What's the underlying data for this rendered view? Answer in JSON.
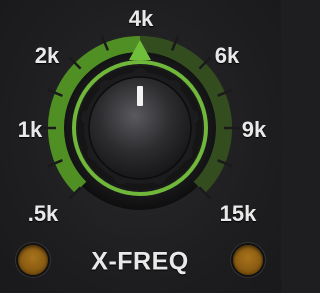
{
  "control": {
    "name": "X-FREQ",
    "type": "rotary-knob",
    "current_value": "4k",
    "accent_color": "#5aa02c",
    "led_color": "#8a5c12",
    "scale_labels": [
      ".5k",
      "1k",
      "2k",
      "4k",
      "6k",
      "9k",
      "15k"
    ]
  },
  "leds": {
    "left_state": "off",
    "right_state": "off"
  }
}
